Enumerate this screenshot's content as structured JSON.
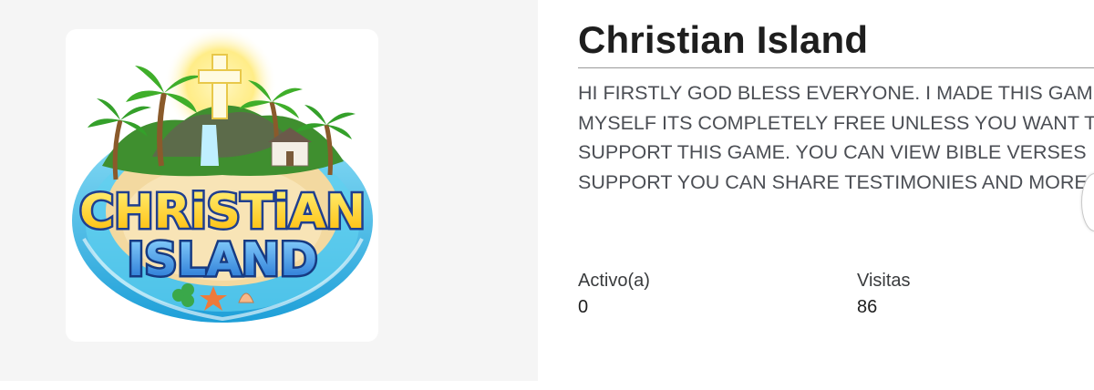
{
  "game": {
    "title": "Christian Island",
    "description": "HI FIRSTLY GOD BLESS EVERYONE. I MADE THIS GAME\nMYSELF ITS COMPLETELY FREE UNLESS YOU WANT TO\nSUPPORT THIS GAME. YOU CAN VIEW BIBLE VERSES\nSUPPORT YOU CAN SHARE TESTIMONIES AND MORE I",
    "thumbnail": {
      "logo_line1": "CHRiSTiAN",
      "logo_line2": "ISLAND"
    }
  },
  "stats": {
    "active": {
      "label": "Activo(a)",
      "value": "0"
    },
    "visits": {
      "label": "Visitas",
      "value": "86"
    }
  },
  "colors": {
    "left_panel_bg": "#f5f5f5",
    "title_text": "#1e1e1e",
    "body_text": "#4b4e54",
    "logo_yellow": "#ffd21f",
    "logo_blue": "#2f8fe0",
    "water": "#4cc3ec",
    "sand": "#f3d9a0"
  },
  "icons": [
    "cross-icon",
    "church-icon",
    "palm-tree-icon",
    "starfish-icon",
    "shell-icon",
    "clover-icon"
  ]
}
